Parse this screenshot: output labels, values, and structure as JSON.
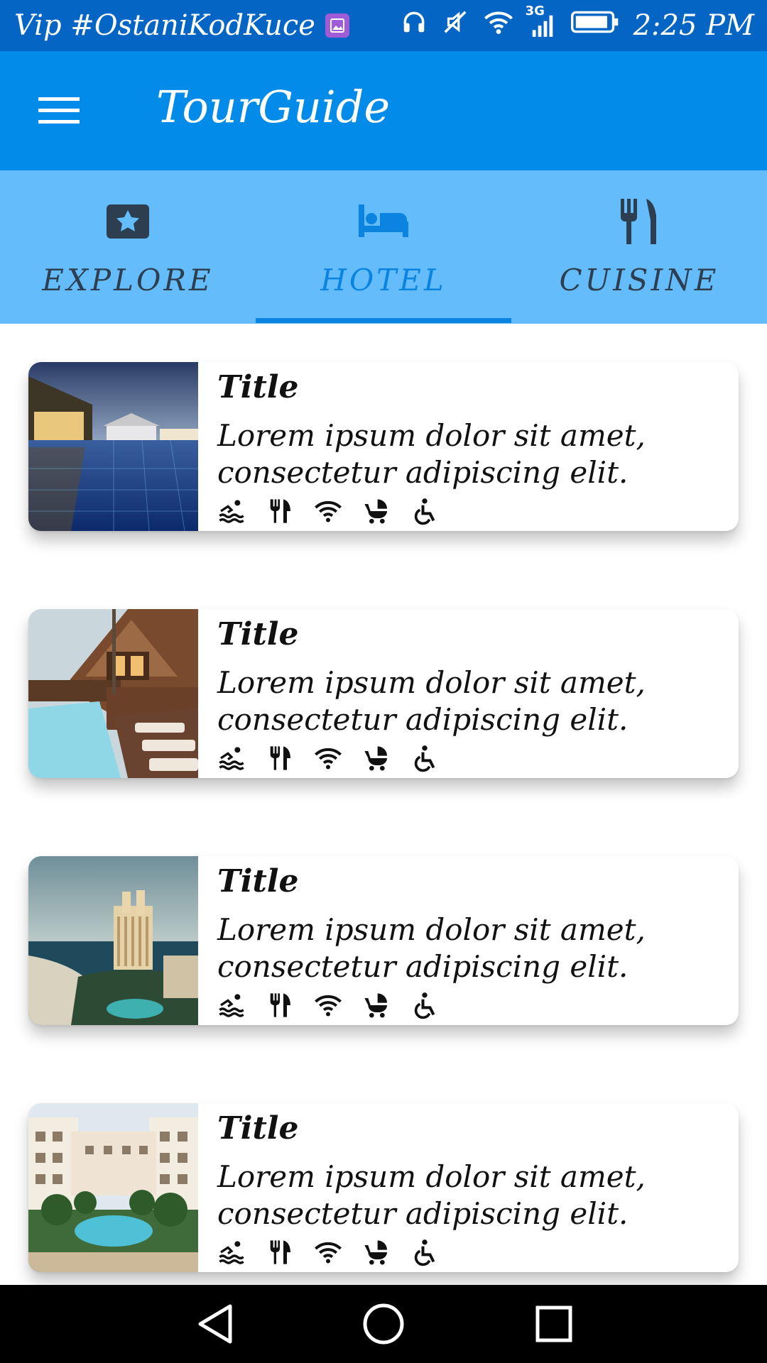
{
  "status_bar": {
    "carrier": "Vip #OstaniKodKuce",
    "network": "3G",
    "time": "2:25 PM",
    "icons": [
      "gallery-icon",
      "headphones-icon",
      "mute-icon",
      "wifi-icon",
      "signal-icon",
      "battery-icon"
    ]
  },
  "app_bar": {
    "title": "TourGuide",
    "menu_icon": "hamburger-menu-icon"
  },
  "tabs": [
    {
      "label": "EXPLORE",
      "icon": "star-badge-icon",
      "active": false
    },
    {
      "label": "HOTEL",
      "icon": "bed-icon",
      "active": true
    },
    {
      "label": "CUISINE",
      "icon": "fork-knife-icon",
      "active": false
    }
  ],
  "cards": [
    {
      "title": "Title",
      "description": "Lorem ipsum dolor sit amet, consectetur adipiscing elit.",
      "image": "hotel-pool-evening"
    },
    {
      "title": "Title",
      "description": "Lorem ipsum dolor sit amet, consectetur adipiscing elit.",
      "image": "wooden-resort-pool"
    },
    {
      "title": "Title",
      "description": "Lorem ipsum dolor sit amet, consectetur adipiscing elit.",
      "image": "beach-tower-hotel"
    },
    {
      "title": "Title",
      "description": "Lorem ipsum dolor sit amet, consectetur adipiscing elit.",
      "image": "courtyard-palm-pool"
    }
  ],
  "amenity_icons": [
    "pool-icon",
    "restaurant-icon",
    "wifi-icon",
    "stroller-icon",
    "wheelchair-icon"
  ],
  "colors": {
    "status_bar": "#0565c4",
    "app_bar": "#028be8",
    "tab_bar": "#64bcfb",
    "tab_active": "#0a84e0",
    "tab_inactive": "#2d3e50"
  },
  "nav_bar": {
    "buttons": [
      "back-icon",
      "home-icon",
      "recents-icon"
    ]
  }
}
